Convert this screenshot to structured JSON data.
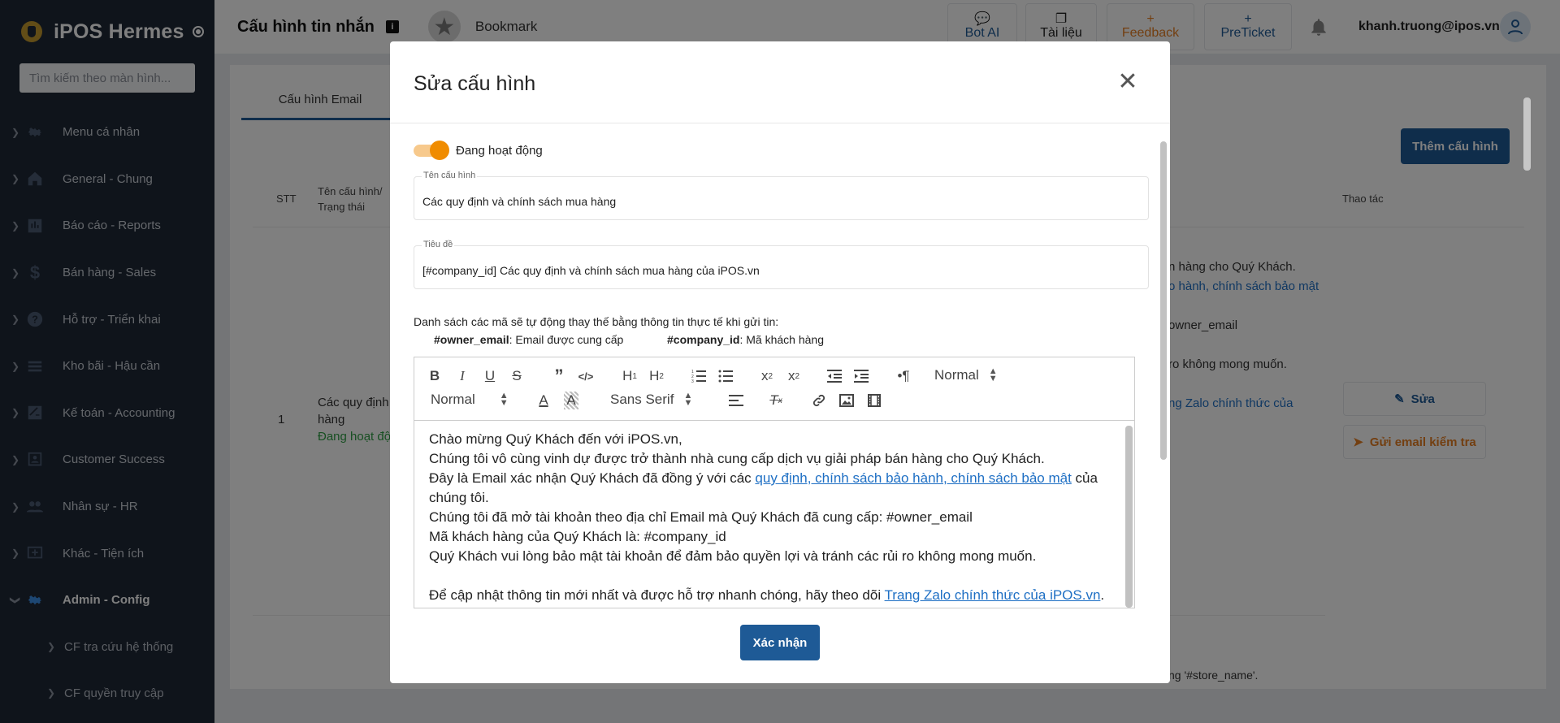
{
  "app": {
    "name": "iPOS Hermes",
    "search_placeholder": "Tìm kiếm theo màn hình..."
  },
  "sidebar": {
    "items": [
      {
        "label": "Menu cá nhân",
        "icon": "gear-icon"
      },
      {
        "label": "General - Chung",
        "icon": "home-icon"
      },
      {
        "label": "Báo cáo - Reports",
        "icon": "chart-icon"
      },
      {
        "label": "Bán hàng - Sales",
        "icon": "dollar-icon"
      },
      {
        "label": "Hỗ trợ - Triển khai",
        "icon": "help-icon"
      },
      {
        "label": "Kho bãi - Hậu cần",
        "icon": "list-icon"
      },
      {
        "label": "Kế toán - Accounting",
        "icon": "accounting-icon"
      },
      {
        "label": "Customer Success",
        "icon": "customer-icon"
      },
      {
        "label": "Nhân sự - HR",
        "icon": "people-icon"
      },
      {
        "label": "Khác - Tiện ích",
        "icon": "add-box-icon"
      },
      {
        "label": "Admin - Config",
        "icon": "gear-icon"
      }
    ],
    "subitems": [
      {
        "label": "CF tra cứu hệ thống"
      },
      {
        "label": "CF quyền truy cập"
      }
    ]
  },
  "topbar": {
    "title": "Cấu hình tin nhắn",
    "info": "i",
    "bookmark": "Bookmark",
    "buttons": [
      {
        "label": "Bot AI",
        "icon": "chat-icon"
      },
      {
        "label": "Tài liệu",
        "icon": "docs-icon"
      },
      {
        "label": "Feedback",
        "icon": "plus-icon"
      },
      {
        "label": "PreTicket",
        "icon": "plus-icon"
      }
    ],
    "user_email": "khanh.truong@ipos.vn"
  },
  "main": {
    "tab": "Cấu hình Email",
    "add_button": "Thêm cấu hình",
    "columns": {
      "stt": "STT",
      "name": "Tên cấu hình/",
      "status": "Trạng thái",
      "action": "Thao tác"
    },
    "row": {
      "stt": "1",
      "name_line1": "Các quy định v",
      "name_line2": "hàng",
      "status": "Đang hoạt độn",
      "frag1": "n hàng cho Quý Khách.",
      "frag2": "o hành, chính sách bảo mật",
      "frag3": "owner_email",
      "frag4": "ro không mong muốn.",
      "frag5": "ng Zalo chính thức của",
      "edit": "Sửa",
      "send": "Gửi email kiểm tra"
    },
    "footer_frag": "ng '#store_name'."
  },
  "modal": {
    "title": "Sửa cấu hình",
    "toggle_label": "Đang hoạt động",
    "toggle_on": true,
    "name_label": "Tên cấu hình",
    "name_value": "Các quy định và chính sách mua hàng",
    "subject_label": "Tiêu đề",
    "subject_value": "[#company_id] Các quy định và chính sách mua hàng của iPOS.vn",
    "hint": "Danh sách các mã sẽ tự động thay thế bằng thông tin thực tế khi gửi tin:",
    "codes": [
      {
        "code": "#owner_email",
        "desc": ": Email được cung cấp"
      },
      {
        "code": "#company_id",
        "desc": ": Mã khách hàng"
      }
    ],
    "toolbar": {
      "header_select": "Normal",
      "size_select": "Normal",
      "font_select": "Sans Serif"
    },
    "content": {
      "l1": "Chào mừng Quý Khách đến với iPOS.vn,",
      "l2": "Chúng tôi vô cùng vinh dự được trở thành nhà cung cấp dịch vụ giải pháp bán hàng cho Quý Khách.",
      "l3_pre": "Đây là Email xác nhận Quý Khách đã đồng ý với các ",
      "l3_link": "quy định, chính sách bảo hành, chính sách bảo mật",
      "l3_post": " của chúng tôi.",
      "l4": "Chúng tôi đã mở tài khoản theo địa chỉ Email mà Quý Khách đã cung cấp: #owner_email",
      "l5": "Mã khách hàng của Quý Khách là: #company_id",
      "l6": "Quý Khách vui lòng bảo mật tài khoản để đảm bảo quyền lợi và tránh các rủi ro không mong muốn.",
      "l7_pre": "Để cập nhật thông tin mới nhất và được hỗ trợ nhanh chóng, hãy theo dõi ",
      "l7_link": "Trang Zalo chính thức của iPOS.vn",
      "l7_post": "."
    },
    "confirm": "Xác nhận"
  },
  "colors": {
    "primary": "#1e5a96",
    "toggle": "#f08c00",
    "sidebar": "#1f2937",
    "status_active": "#2f9e44"
  }
}
